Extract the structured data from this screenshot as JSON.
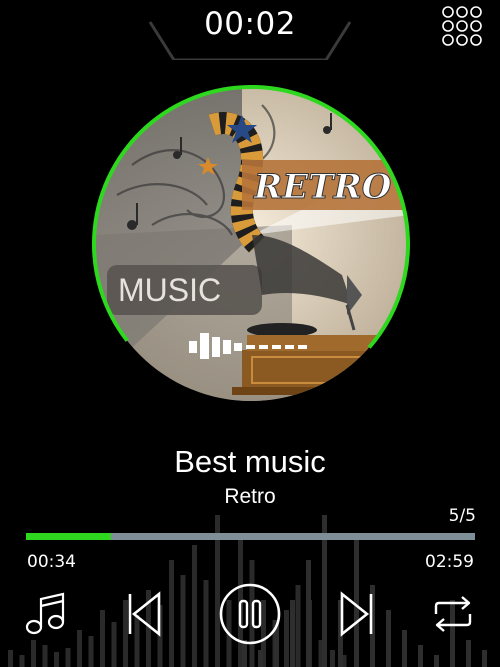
{
  "status": {
    "clock": "00:02"
  },
  "album_art": {
    "caption_retro": "RETRO",
    "caption_music": "MUSIC"
  },
  "track": {
    "title": "Best music",
    "artist": "Retro",
    "position_label": "5/5",
    "elapsed": "00:34",
    "duration": "02:59",
    "progress_fraction": 0.19,
    "ring_fraction": 0.72
  },
  "controls": {
    "playlist_icon": "music-note-icon",
    "prev_icon": "skip-previous-icon",
    "pause_icon": "pause-icon",
    "next_icon": "skip-next-icon",
    "repeat_icon": "repeat-icon",
    "apps_icon": "grid-menu-icon"
  },
  "colors": {
    "accent": "#2ed81e",
    "track_bg": "#7f8f97",
    "background": "#000000"
  }
}
